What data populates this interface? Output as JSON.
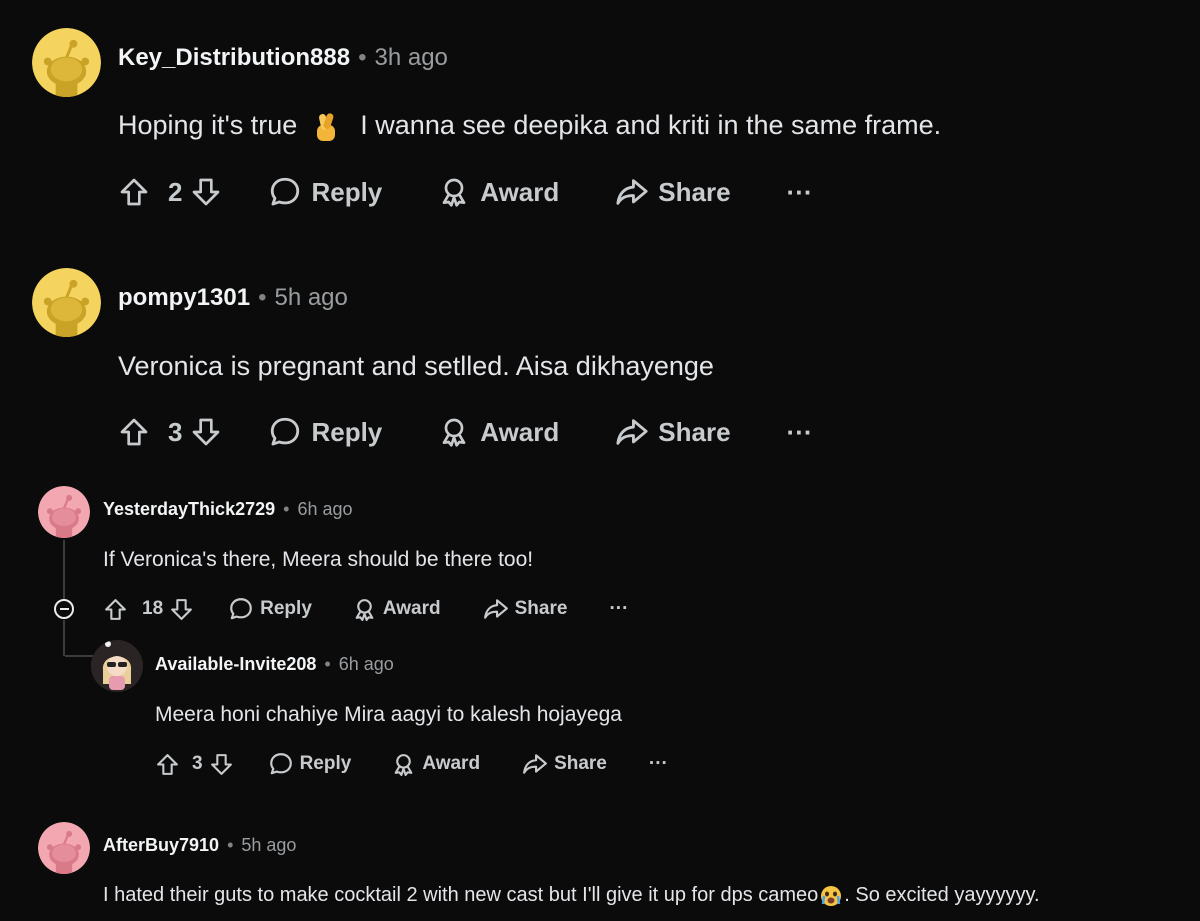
{
  "comments": [
    {
      "username": "Key_Distribution888",
      "time": "3h ago",
      "text_before": "Hoping it's true",
      "emoji": "crossed-fingers-emoji",
      "text_after": "I wanna see deepika and kriti in the same frame.",
      "votes": "2",
      "avatar": "snoo-yellow"
    },
    {
      "username": "pompy1301",
      "time": "5h ago",
      "text": "Veronica is pregnant and setlled. Aisa dikhayenge",
      "votes": "3",
      "avatar": "snoo-yellow"
    },
    {
      "username": "YesterdayThick2729",
      "time": "6h ago",
      "text": "If Veronica's there, Meera should be there too!",
      "votes": "18",
      "avatar": "snoo-pink"
    },
    {
      "username": "Available-Invite208",
      "time": "6h ago",
      "text": "Meera honi chahiye Mira aagyi to kalesh hojayega",
      "votes": "3",
      "avatar": "custom-avatar-sunglasses"
    },
    {
      "username": "AfterBuy7910",
      "time": "5h ago",
      "text_before": "I hated their guts to make cocktail 2 with new cast but I'll give it up for dps cameo",
      "emoji": "crying-face-emoji",
      "text_after": ". So excited yayyyyyy.",
      "avatar": "snoo-pink"
    }
  ],
  "actions": {
    "reply": "Reply",
    "award": "Award",
    "share": "Share",
    "more": "···"
  },
  "icons": [
    "upvote-icon",
    "downvote-icon",
    "reply-icon",
    "award-icon",
    "share-icon",
    "more-icon",
    "collapse-icon"
  ],
  "colors": {
    "background": "#0b0b0c",
    "avatar_yellow": "#f4d35e",
    "avatar_pink": "#f2a7b1",
    "text": "#d7dadc"
  }
}
